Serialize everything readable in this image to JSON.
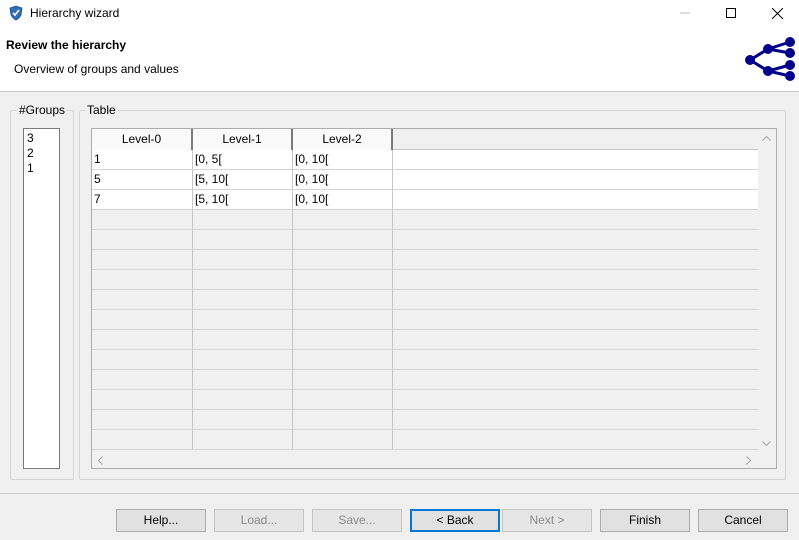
{
  "window": {
    "title": "Hierarchy wizard",
    "minimize_icon": "minimize-icon",
    "maximize_icon": "maximize-icon",
    "close_icon": "close-icon"
  },
  "header": {
    "title": "Review the hierarchy",
    "subtitle": "Overview of groups and values",
    "logo_icon": "hierarchy-tree-icon",
    "logo_color": "#00008b"
  },
  "groups": {
    "label": "#Groups",
    "items": [
      "3",
      "2",
      "1"
    ]
  },
  "table": {
    "label": "Table",
    "columns": [
      "Level-0",
      "Level-1",
      "Level-2"
    ],
    "rows": [
      [
        "1",
        "[0, 5[",
        "[0, 10["
      ],
      [
        "5",
        "[5, 10[",
        "[0, 10["
      ],
      [
        "7",
        "[5, 10[",
        "[0, 10["
      ]
    ]
  },
  "buttons": {
    "help": "Help...",
    "load": "Load...",
    "save": "Save...",
    "back": "< Back",
    "next": "Next >",
    "finish": "Finish",
    "cancel": "Cancel"
  }
}
